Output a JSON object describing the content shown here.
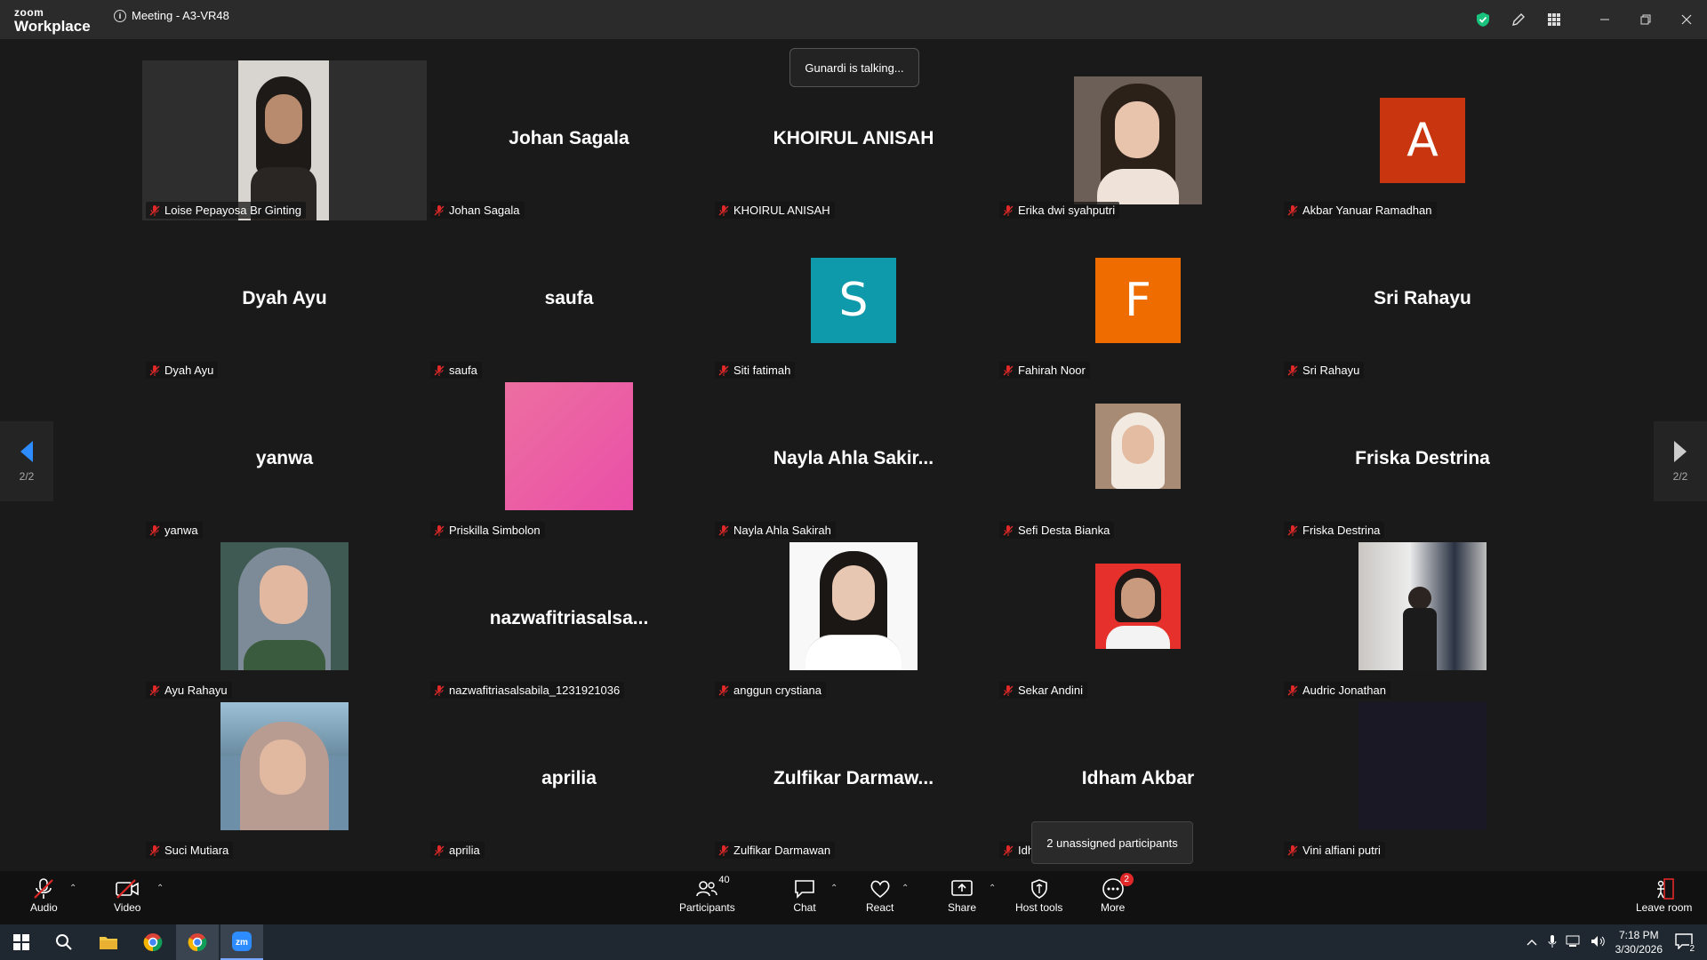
{
  "app": {
    "logo_top": "zoom",
    "logo_bottom": "Workplace",
    "meeting_title": "Meeting - A3-VR48"
  },
  "talking_indicator": "Gunardi is talking...",
  "pager": {
    "left": "2/2",
    "right": "2/2"
  },
  "tiles": [
    {
      "label": "Loise Pepayosa Br Ginting",
      "big": ""
    },
    {
      "label": "Johan Sagala",
      "big": "Johan Sagala"
    },
    {
      "label": "KHOIRUL ANISAH",
      "big": "KHOIRUL ANISAH"
    },
    {
      "label": "Erika dwi syahputri",
      "big": ""
    },
    {
      "label": "Akbar Yanuar Ramadhan",
      "big": "",
      "avatar_letter": "A",
      "avatar_color": "#c9350f"
    },
    {
      "label": "Dyah Ayu",
      "big": "Dyah Ayu"
    },
    {
      "label": "saufa",
      "big": "saufa"
    },
    {
      "label": "Siti fatimah",
      "big": "",
      "avatar_letter": "S",
      "avatar_color": "#0e9aaa"
    },
    {
      "label": "Fahirah Noor",
      "big": "",
      "avatar_letter": "F",
      "avatar_color": "#ef6c00"
    },
    {
      "label": "Sri Rahayu",
      "big": "Sri Rahayu"
    },
    {
      "label": "yanwa",
      "big": "yanwa"
    },
    {
      "label": "Priskilla Simbolon",
      "big": ""
    },
    {
      "label": "Nayla Ahla Sakirah",
      "big": "Nayla  Ahla  Sakir..."
    },
    {
      "label": "Sefi Desta Bianka",
      "big": ""
    },
    {
      "label": "Friska Destrina",
      "big": "Friska Destrina"
    },
    {
      "label": "Ayu Rahayu",
      "big": ""
    },
    {
      "label": "nazwafitriasalsabila_1231921036",
      "big": "nazwafitriasalsa..."
    },
    {
      "label": "anggun crystiana",
      "big": ""
    },
    {
      "label": "Sekar Andini",
      "big": ""
    },
    {
      "label": "Audric Jonathan",
      "big": ""
    },
    {
      "label": "Suci Mutiara",
      "big": ""
    },
    {
      "label": "aprilia",
      "big": "aprilia"
    },
    {
      "label": "Zulfikar Darmawan",
      "big": "Zulfikar  Darmaw..."
    },
    {
      "label": "Idh",
      "big": "Idham Akbar"
    },
    {
      "label": "Vini alfiani putri",
      "big": ""
    }
  ],
  "tooltip": "2 unassigned participants",
  "toolbar": {
    "audio": "Audio",
    "video": "Video",
    "participants": "Participants",
    "participants_count": "40",
    "chat": "Chat",
    "react": "React",
    "share": "Share",
    "host_tools": "Host tools",
    "more": "More",
    "more_badge": "2",
    "leave": "Leave room"
  },
  "taskbar": {
    "time": "7:18 PM",
    "date": "3/30/2026",
    "notif_count": "2"
  },
  "colors": {
    "accent_green": "#19c37d",
    "mic_red": "#e02828"
  }
}
